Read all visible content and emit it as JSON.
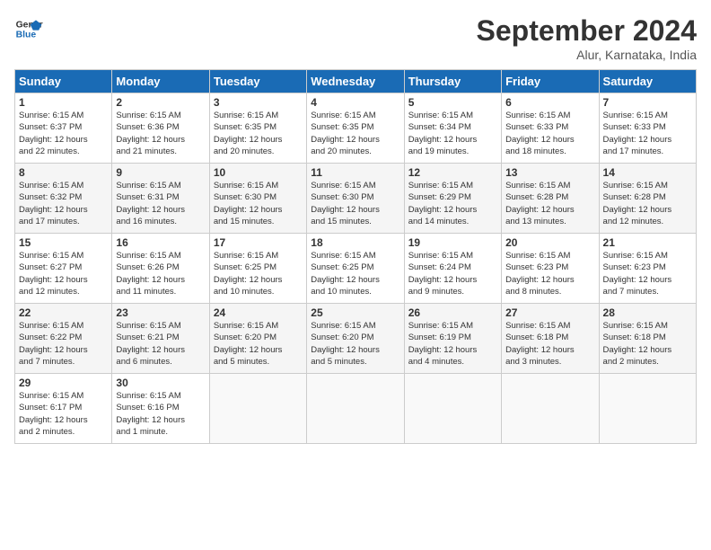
{
  "logo": {
    "line1": "General",
    "line2": "Blue"
  },
  "title": "September 2024",
  "location": "Alur, Karnataka, India",
  "headers": [
    "Sunday",
    "Monday",
    "Tuesday",
    "Wednesday",
    "Thursday",
    "Friday",
    "Saturday"
  ],
  "weeks": [
    [
      {
        "day": "1",
        "info": "Sunrise: 6:15 AM\nSunset: 6:37 PM\nDaylight: 12 hours\nand 22 minutes."
      },
      {
        "day": "2",
        "info": "Sunrise: 6:15 AM\nSunset: 6:36 PM\nDaylight: 12 hours\nand 21 minutes."
      },
      {
        "day": "3",
        "info": "Sunrise: 6:15 AM\nSunset: 6:35 PM\nDaylight: 12 hours\nand 20 minutes."
      },
      {
        "day": "4",
        "info": "Sunrise: 6:15 AM\nSunset: 6:35 PM\nDaylight: 12 hours\nand 20 minutes."
      },
      {
        "day": "5",
        "info": "Sunrise: 6:15 AM\nSunset: 6:34 PM\nDaylight: 12 hours\nand 19 minutes."
      },
      {
        "day": "6",
        "info": "Sunrise: 6:15 AM\nSunset: 6:33 PM\nDaylight: 12 hours\nand 18 minutes."
      },
      {
        "day": "7",
        "info": "Sunrise: 6:15 AM\nSunset: 6:33 PM\nDaylight: 12 hours\nand 17 minutes."
      }
    ],
    [
      {
        "day": "8",
        "info": "Sunrise: 6:15 AM\nSunset: 6:32 PM\nDaylight: 12 hours\nand 17 minutes."
      },
      {
        "day": "9",
        "info": "Sunrise: 6:15 AM\nSunset: 6:31 PM\nDaylight: 12 hours\nand 16 minutes."
      },
      {
        "day": "10",
        "info": "Sunrise: 6:15 AM\nSunset: 6:30 PM\nDaylight: 12 hours\nand 15 minutes."
      },
      {
        "day": "11",
        "info": "Sunrise: 6:15 AM\nSunset: 6:30 PM\nDaylight: 12 hours\nand 15 minutes."
      },
      {
        "day": "12",
        "info": "Sunrise: 6:15 AM\nSunset: 6:29 PM\nDaylight: 12 hours\nand 14 minutes."
      },
      {
        "day": "13",
        "info": "Sunrise: 6:15 AM\nSunset: 6:28 PM\nDaylight: 12 hours\nand 13 minutes."
      },
      {
        "day": "14",
        "info": "Sunrise: 6:15 AM\nSunset: 6:28 PM\nDaylight: 12 hours\nand 12 minutes."
      }
    ],
    [
      {
        "day": "15",
        "info": "Sunrise: 6:15 AM\nSunset: 6:27 PM\nDaylight: 12 hours\nand 12 minutes."
      },
      {
        "day": "16",
        "info": "Sunrise: 6:15 AM\nSunset: 6:26 PM\nDaylight: 12 hours\nand 11 minutes."
      },
      {
        "day": "17",
        "info": "Sunrise: 6:15 AM\nSunset: 6:25 PM\nDaylight: 12 hours\nand 10 minutes."
      },
      {
        "day": "18",
        "info": "Sunrise: 6:15 AM\nSunset: 6:25 PM\nDaylight: 12 hours\nand 10 minutes."
      },
      {
        "day": "19",
        "info": "Sunrise: 6:15 AM\nSunset: 6:24 PM\nDaylight: 12 hours\nand 9 minutes."
      },
      {
        "day": "20",
        "info": "Sunrise: 6:15 AM\nSunset: 6:23 PM\nDaylight: 12 hours\nand 8 minutes."
      },
      {
        "day": "21",
        "info": "Sunrise: 6:15 AM\nSunset: 6:23 PM\nDaylight: 12 hours\nand 7 minutes."
      }
    ],
    [
      {
        "day": "22",
        "info": "Sunrise: 6:15 AM\nSunset: 6:22 PM\nDaylight: 12 hours\nand 7 minutes."
      },
      {
        "day": "23",
        "info": "Sunrise: 6:15 AM\nSunset: 6:21 PM\nDaylight: 12 hours\nand 6 minutes."
      },
      {
        "day": "24",
        "info": "Sunrise: 6:15 AM\nSunset: 6:20 PM\nDaylight: 12 hours\nand 5 minutes."
      },
      {
        "day": "25",
        "info": "Sunrise: 6:15 AM\nSunset: 6:20 PM\nDaylight: 12 hours\nand 5 minutes."
      },
      {
        "day": "26",
        "info": "Sunrise: 6:15 AM\nSunset: 6:19 PM\nDaylight: 12 hours\nand 4 minutes."
      },
      {
        "day": "27",
        "info": "Sunrise: 6:15 AM\nSunset: 6:18 PM\nDaylight: 12 hours\nand 3 minutes."
      },
      {
        "day": "28",
        "info": "Sunrise: 6:15 AM\nSunset: 6:18 PM\nDaylight: 12 hours\nand 2 minutes."
      }
    ],
    [
      {
        "day": "29",
        "info": "Sunrise: 6:15 AM\nSunset: 6:17 PM\nDaylight: 12 hours\nand 2 minutes."
      },
      {
        "day": "30",
        "info": "Sunrise: 6:15 AM\nSunset: 6:16 PM\nDaylight: 12 hours\nand 1 minute."
      },
      {
        "day": "",
        "info": ""
      },
      {
        "day": "",
        "info": ""
      },
      {
        "day": "",
        "info": ""
      },
      {
        "day": "",
        "info": ""
      },
      {
        "day": "",
        "info": ""
      }
    ]
  ]
}
